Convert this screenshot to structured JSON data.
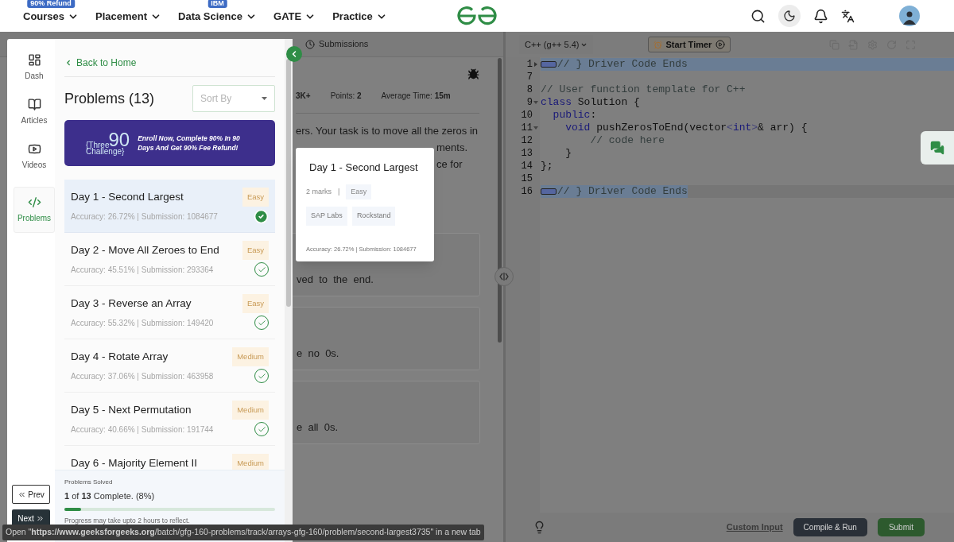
{
  "nav": {
    "items": [
      {
        "label": "Courses",
        "badge": "90% Refund"
      },
      {
        "label": "Placement"
      },
      {
        "label": "Data Science",
        "badge": "IBM"
      },
      {
        "label": "GATE"
      },
      {
        "label": "Practice"
      }
    ]
  },
  "problem_panel": {
    "tabs": [
      {
        "label": "Submissions",
        "selected": false
      }
    ],
    "stats": [
      "3K+",
      "Points: **2**",
      "Average Time: **15m**"
    ],
    "description": [
      {
        "kind": "full",
        "text": "ers. Your task is to move all the zeros in"
      },
      {
        "kind": "partial",
        "text": "ments."
      },
      {
        "kind": "partial",
        "text": "ce for"
      }
    ],
    "examples": [
      "ved  to  the  end.",
      "e  no  0s.",
      "e  all  0s."
    ]
  },
  "drawer": {
    "rail": [
      {
        "label": "Dash",
        "kind": "dash",
        "selected": false
      },
      {
        "label": "Articles",
        "kind": "articles",
        "selected": false
      },
      {
        "label": "Videos",
        "kind": "videos",
        "selected": false
      },
      {
        "label": "Problems",
        "kind": "problems",
        "selected": true
      }
    ],
    "back_link": "Back to Home",
    "title": "Problems (13)",
    "sort": {
      "placeholder": "Sort By"
    },
    "banner": {
      "logo": [
        "{Three",
        "90",
        "Challenge}"
      ],
      "text": "Enroll Now, Complete 90% In 90 Days And Get 90% Fee Refund!"
    },
    "problems": [
      {
        "title": "Day 1 - Second Largest",
        "difficulty": "Easy",
        "stats": "Accuracy: 26.72% | Submission: 1084677",
        "solved": true,
        "selected": true
      },
      {
        "title": "Day 2 - Move All Zeroes to End",
        "difficulty": "Easy",
        "stats": "Accuracy: 45.51% | Submission: 293364",
        "solved": true,
        "selected": false
      },
      {
        "title": "Day 3 - Reverse an Array",
        "difficulty": "Easy",
        "stats": "Accuracy: 55.32% | Submission: 149420",
        "solved": true,
        "selected": false
      },
      {
        "title": "Day 4 - Rotate Array",
        "difficulty": "Medium",
        "stats": "Accuracy: 37.06% | Submission: 463958",
        "solved": true,
        "selected": false
      },
      {
        "title": "Day 5 - Next Permutation",
        "difficulty": "Medium",
        "stats": "Accuracy: 40.66% | Submission: 191744",
        "solved": true,
        "selected": false
      },
      {
        "title": "Day 6 - Majority Element II",
        "difficulty": "Medium",
        "selected": false
      }
    ],
    "progress": {
      "label": "Problems Solved",
      "summary": "**1** of **13** Complete. (8%)",
      "level": 0.08,
      "note": "Progress may take upto 2 hours to reflect."
    },
    "prev": "Prev",
    "next": "Next"
  },
  "popover": {
    "title": "Day 1 - Second Largest",
    "marks": "2 marks",
    "separator": "|",
    "difficulty": "Easy",
    "tags": [
      "SAP Labs",
      "Rockstand"
    ],
    "stats": "Accuracy: 26.72% | Submission: 1084677"
  },
  "editor": {
    "language": "C++ (g++ 5.4)",
    "timer": "Start Timer",
    "lines": [
      {
        "number": "1",
        "folded": true,
        "selected": true,
        "active": false,
        "marker": true,
        "tokens": [
          {
            "kind": "comment",
            "text": "// } Driver Code Ends"
          }
        ]
      },
      {
        "number": "7"
      },
      {
        "number": "8",
        "tokens": [
          {
            "kind": "comment",
            "text": "// User function template for C++"
          }
        ]
      },
      {
        "number": "9",
        "folded": false,
        "tokens": [
          {
            "kind": "keyword",
            "text": "class"
          },
          {
            "kind": "plain",
            "text": " Solution {"
          }
        ]
      },
      {
        "number": "10",
        "tokens": [
          {
            "kind": "keyword",
            "text": "  public"
          },
          {
            "kind": "plain",
            "text": ":"
          }
        ]
      },
      {
        "number": "11",
        "folded": false,
        "tokens": [
          {
            "kind": "keyword",
            "text": "    void"
          },
          {
            "kind": "plain",
            "text": " pushZerosToEnd(vector"
          },
          {
            "kind": "punct",
            "text": "<"
          },
          {
            "kind": "keyword",
            "text": "int"
          },
          {
            "kind": "punct",
            "text": ">"
          },
          {
            "kind": "plain",
            "text": "& arr) {"
          }
        ]
      },
      {
        "number": "12",
        "tokens": [
          {
            "kind": "comment",
            "text": "        // code here"
          }
        ]
      },
      {
        "number": "13",
        "tokens": [
          {
            "kind": "plain",
            "text": "    }"
          }
        ]
      },
      {
        "number": "14",
        "tokens": [
          {
            "kind": "plain",
            "text": "};"
          }
        ]
      },
      {
        "number": "15"
      },
      {
        "number": "16",
        "selected": true,
        "active": true,
        "marker": true,
        "tokens": [
          {
            "kind": "comment",
            "text": "// } Driver Code Ends"
          }
        ]
      }
    ],
    "custom_input": "Custom Input",
    "compile": "Compile & Run",
    "submit": "Submit"
  },
  "status_bar": "Open \"**https://www.geeksforgeeks.org**/batch/gfg-160-problems/track/arrays-gfg-160/problem/second-largest3735\" in a new tab"
}
